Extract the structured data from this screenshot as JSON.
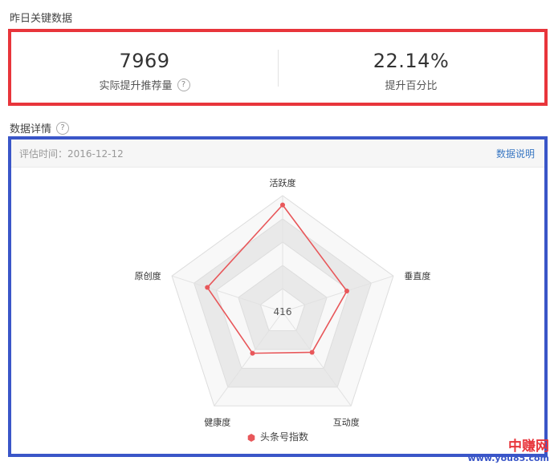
{
  "yesterday_section": {
    "title": "昨日关键数据"
  },
  "stats": [
    {
      "value": "7969",
      "label": "实际提升推荐量",
      "has_help": true
    },
    {
      "value": "22.14%",
      "label": "提升百分比",
      "has_help": false
    }
  ],
  "detail_section": {
    "title": "数据详情"
  },
  "detail_header": {
    "eval_date": "评估时间：2016-12-12",
    "explain_link": "数据说明"
  },
  "colors": {
    "series": "#e8575a",
    "key_border": "#e8353b",
    "detail_border": "#3a56c8",
    "link": "#3a78c3"
  },
  "chart_data": {
    "type": "radar",
    "axes": [
      "活跃度",
      "垂直度",
      "互动度",
      "健康度",
      "原创度"
    ],
    "series": [
      {
        "name": "头条号指数",
        "values": [
          0.92,
          0.58,
          0.43,
          0.44,
          0.68
        ]
      }
    ],
    "center_label": "416",
    "range": [
      0,
      1
    ],
    "levels": 5
  },
  "watermark": {
    "line1": "中赚网",
    "line2": "www.you85.com"
  }
}
